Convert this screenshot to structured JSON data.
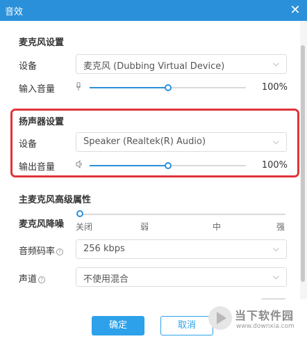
{
  "window": {
    "title": "音效"
  },
  "mic_settings": {
    "section_title": "麦克风设置",
    "device_label": "设备",
    "device_value": "麦克风 (Dubbing Virtual Device)",
    "volume_label": "输入音量",
    "volume_value": "100%",
    "volume_level": 0.5
  },
  "speaker_settings": {
    "section_title": "扬声器设置",
    "device_label": "设备",
    "device_value": "Speaker (Realtek(R) Audio)",
    "volume_label": "输出音量",
    "volume_value": "100%",
    "volume_level": 0.5
  },
  "mic_advanced": {
    "section_title": "主麦克风高级属性",
    "noise_reduction_label": "麦克风降噪",
    "noise_reduction_ticks": [
      "关闭",
      "弱",
      "中",
      "强"
    ],
    "noise_reduction_level": 0,
    "bitrate_label": "音频码率",
    "bitrate_value": "256 kbps",
    "channel_label": "声道",
    "channel_value": "不使用混合"
  },
  "footer": {
    "ok_label": "确定",
    "cancel_label": "取消"
  },
  "watermark": {
    "line1": "当下软件园",
    "line2": "www.downxia.com"
  },
  "colors": {
    "titlebar": "#2a90d9",
    "accent": "#2da1ea",
    "highlight": "#e0343a"
  },
  "icons": {
    "close": "close-icon",
    "chevron": "chevron-down-icon",
    "mic": "microphone-icon",
    "speaker": "speaker-icon",
    "help": "help-icon"
  }
}
